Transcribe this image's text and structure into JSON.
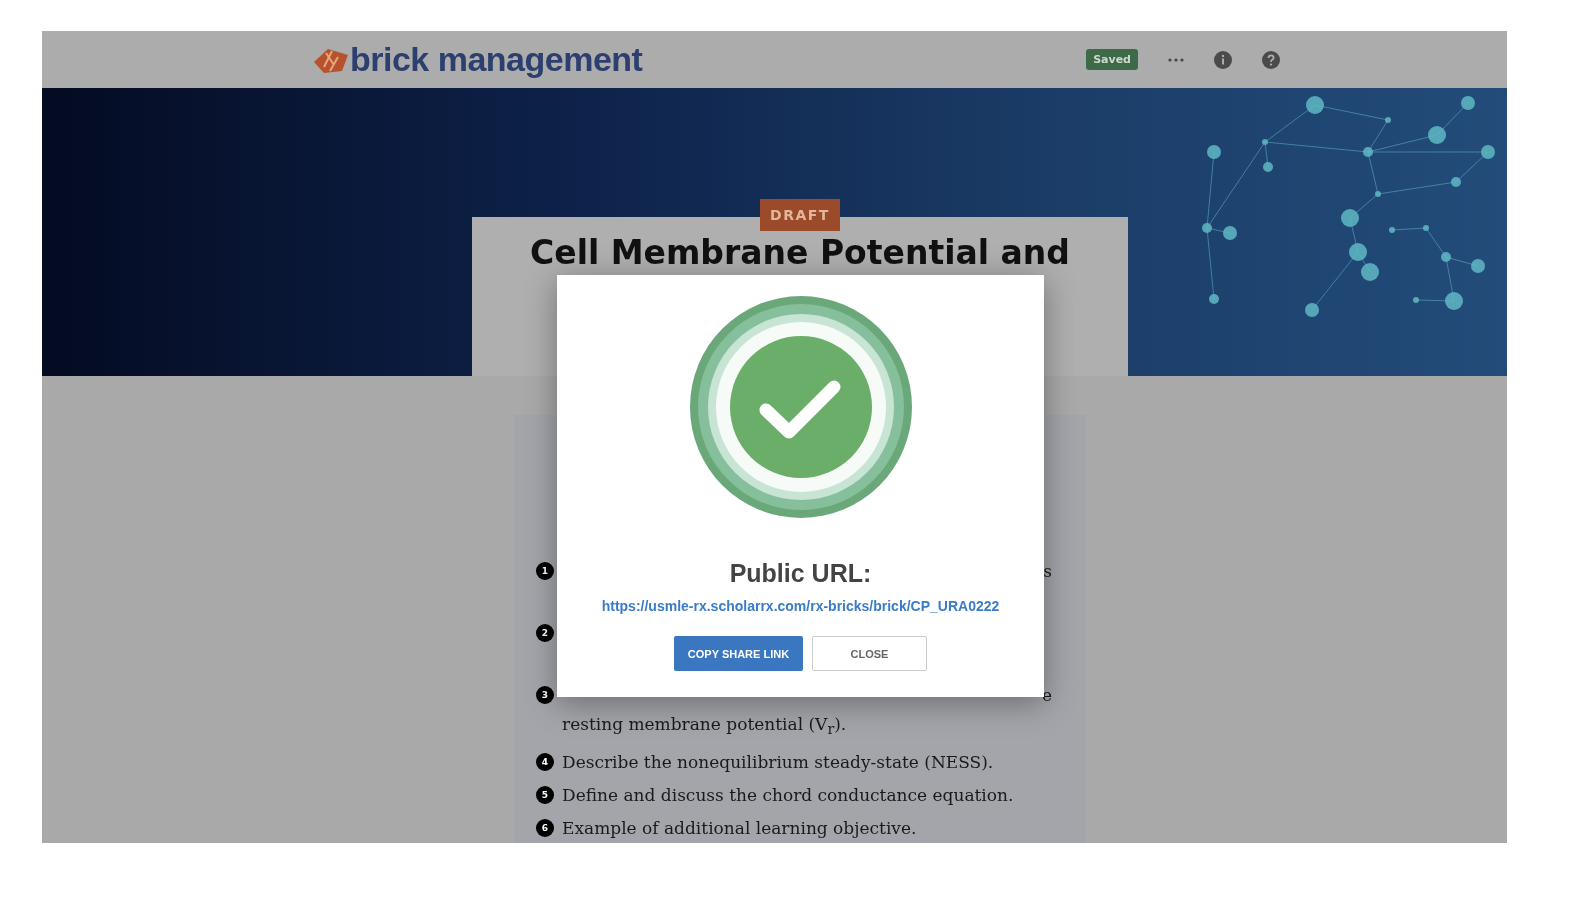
{
  "header": {
    "logo_text": "brick management",
    "status_badge": "Saved"
  },
  "hero": {
    "badge": "DRAFT",
    "title": "Cell Membrane Potential and"
  },
  "objectives": [
    {
      "number": "1",
      "tail": "s"
    },
    {
      "number": "2"
    },
    {
      "number": "3",
      "tail": "e",
      "lines": [
        "resting membrane potential (V$_{r}$)."
      ]
    },
    {
      "number": "4",
      "lines": [
        "Describe the nonequilibrium steady-state (NESS)."
      ]
    },
    {
      "number": "5",
      "lines": [
        "Define and discuss the chord conductance equation."
      ]
    },
    {
      "number": "6",
      "lines": [
        "Example of additional learning objective."
      ]
    }
  ],
  "modal": {
    "title": "Public URL:",
    "url": "https://usmle-rx.scholarrx.com/rx-bricks/brick/CP_URA0222",
    "buttons": [
      {
        "label": "COPY SHARE LINK",
        "kind": "primary"
      },
      {
        "label": "CLOSE",
        "kind": "secondary"
      }
    ]
  }
}
